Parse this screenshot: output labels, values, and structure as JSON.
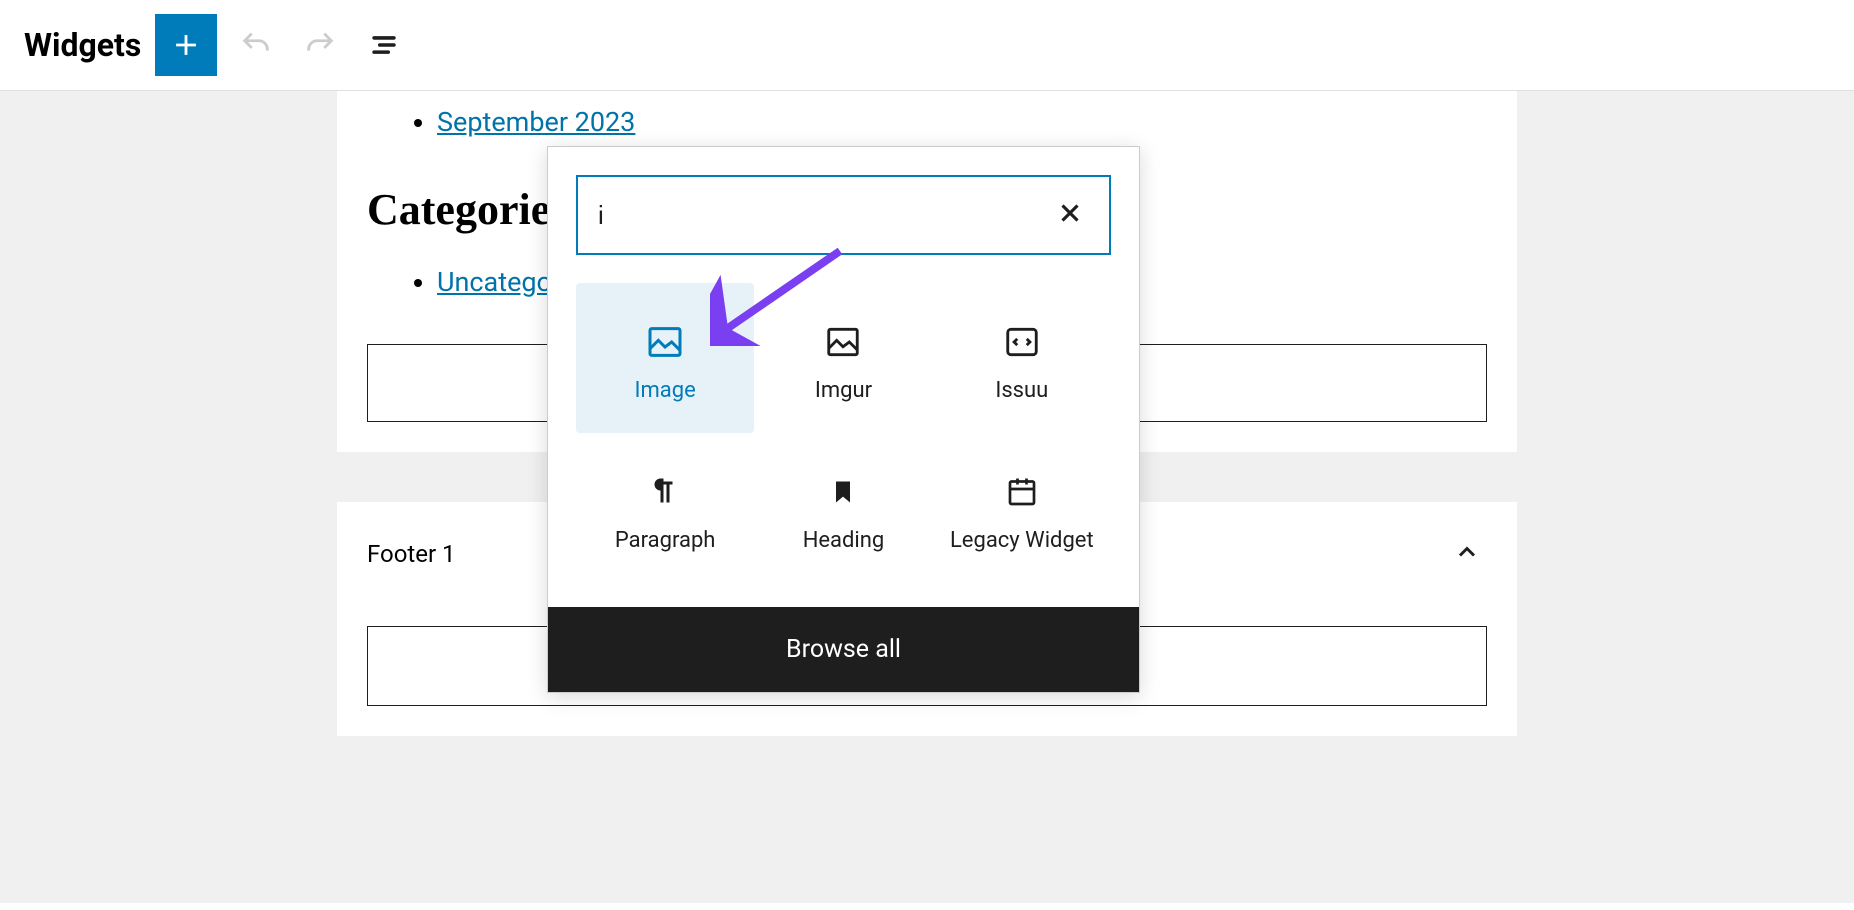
{
  "header": {
    "title": "Widgets"
  },
  "widget_area_1": {
    "archive_link": "September 2023",
    "categories_heading": "Categories",
    "category_link": "Uncategorized"
  },
  "footer_area": {
    "title": "Footer 1"
  },
  "inserter": {
    "search_value": "i",
    "blocks": [
      {
        "label": "Image",
        "selected": true
      },
      {
        "label": "Imgur",
        "selected": false
      },
      {
        "label": "Issuu",
        "selected": false
      },
      {
        "label": "Paragraph",
        "selected": false
      },
      {
        "label": "Heading",
        "selected": false
      },
      {
        "label": "Legacy Widget",
        "selected": false
      }
    ],
    "browse_all_label": "Browse all"
  }
}
